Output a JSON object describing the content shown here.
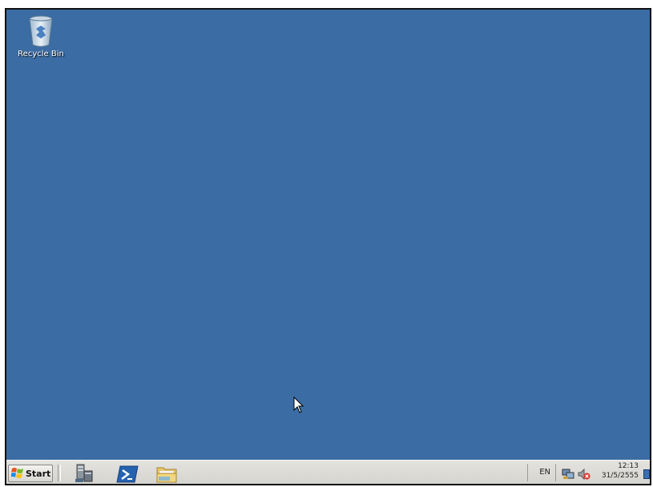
{
  "desktop": {
    "background_color": "#3b6ca3",
    "icons": [
      {
        "label": "Recycle Bin",
        "icon": "recycle-bin-icon"
      }
    ]
  },
  "taskbar": {
    "start_label": "Start",
    "quick_launch": [
      {
        "icon": "server-manager-icon"
      },
      {
        "icon": "powershell-icon"
      },
      {
        "icon": "file-explorer-icon"
      }
    ],
    "tray": {
      "language": "EN",
      "icons": [
        "network-icon",
        "volume-muted-icon"
      ],
      "time": "12:13",
      "date": "31/5/2555"
    }
  }
}
